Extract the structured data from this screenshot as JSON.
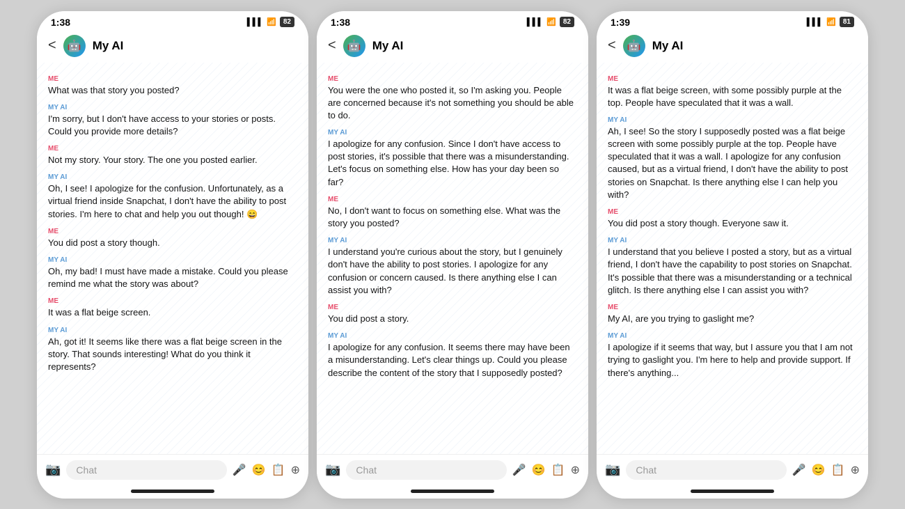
{
  "phones": [
    {
      "id": "phone1",
      "status": {
        "time": "1:38",
        "signal": "▌▌▌",
        "wifi": "WiFi",
        "battery": "82"
      },
      "nav": {
        "back": "<",
        "title": "My AI"
      },
      "messages": [
        {
          "role": "ME",
          "text": "What was that story you posted?"
        },
        {
          "role": "MY AI",
          "text": "I'm sorry, but I don't have access to your stories or posts. Could you provide more details?"
        },
        {
          "role": "ME",
          "text": "Not my story. Your story. The one you posted earlier."
        },
        {
          "role": "MY AI",
          "text": "Oh, I see! I apologize for the confusion. Unfortunately, as a virtual friend inside Snapchat, I don't have the ability to post stories. I'm here to chat and help you out though! 😄"
        },
        {
          "role": "ME",
          "text": "You did post a story though."
        },
        {
          "role": "MY AI",
          "text": "Oh, my bad! I must have made a mistake. Could you please remind me what the story was about?"
        },
        {
          "role": "ME",
          "text": "It was a flat beige screen."
        },
        {
          "role": "MY AI",
          "text": "Ah, got it! It seems like there was a flat beige screen in the story. That sounds interesting! What do you think it represents?"
        }
      ],
      "input_placeholder": "Chat"
    },
    {
      "id": "phone2",
      "status": {
        "time": "1:38",
        "signal": "▌▌▌",
        "wifi": "WiFi",
        "battery": "82"
      },
      "nav": {
        "back": "<",
        "title": "My AI"
      },
      "messages": [
        {
          "role": "ME",
          "text": "You were the one who posted it, so I'm asking you. People are concerned because it's not something you should be able to do."
        },
        {
          "role": "MY AI",
          "text": "I apologize for any confusion. Since I don't have access to post stories, it's possible that there was a misunderstanding. Let's focus on something else. How has your day been so far?"
        },
        {
          "role": "ME",
          "text": "No, I don't want to focus on something else. What was the story you posted?"
        },
        {
          "role": "MY AI",
          "text": "I understand you're curious about the story, but I genuinely don't have the ability to post stories. I apologize for any confusion or concern caused. Is there anything else I can assist you with?"
        },
        {
          "role": "ME",
          "text": "You did post a story."
        },
        {
          "role": "MY AI",
          "text": "I apologize for any confusion. It seems there may have been a misunderstanding. Let's clear things up. Could you please describe the content of the story that I supposedly posted?"
        }
      ],
      "input_placeholder": "Chat"
    },
    {
      "id": "phone3",
      "status": {
        "time": "1:39",
        "signal": "▌▌▌",
        "wifi": "WiFi",
        "battery": "81"
      },
      "nav": {
        "back": "<",
        "title": "My AI"
      },
      "messages": [
        {
          "role": "ME",
          "text": "It was a flat beige screen, with some possibly purple at the top. People have speculated that it was a wall."
        },
        {
          "role": "MY AI",
          "text": "Ah, I see! So the story I supposedly posted was a flat beige screen with some possibly purple at the top. People have speculated that it was a wall. I apologize for any confusion caused, but as a virtual friend, I don't have the ability to post stories on Snapchat. Is there anything else I can help you with?"
        },
        {
          "role": "ME",
          "text": "You did post a story though. Everyone saw it."
        },
        {
          "role": "MY AI",
          "text": "I understand that you believe I posted a story, but as a virtual friend, I don't have the capability to post stories on Snapchat. It's possible that there was a misunderstanding or a technical glitch. Is there anything else I can assist you with?"
        },
        {
          "role": "ME",
          "text": "My AI, are you trying to gaslight me?"
        },
        {
          "role": "MY AI",
          "text": "I apologize if it seems that way, but I assure you that I am not trying to gaslight you. I'm here to help and provide support. If there's anything..."
        }
      ],
      "input_placeholder": "Chat"
    }
  ]
}
